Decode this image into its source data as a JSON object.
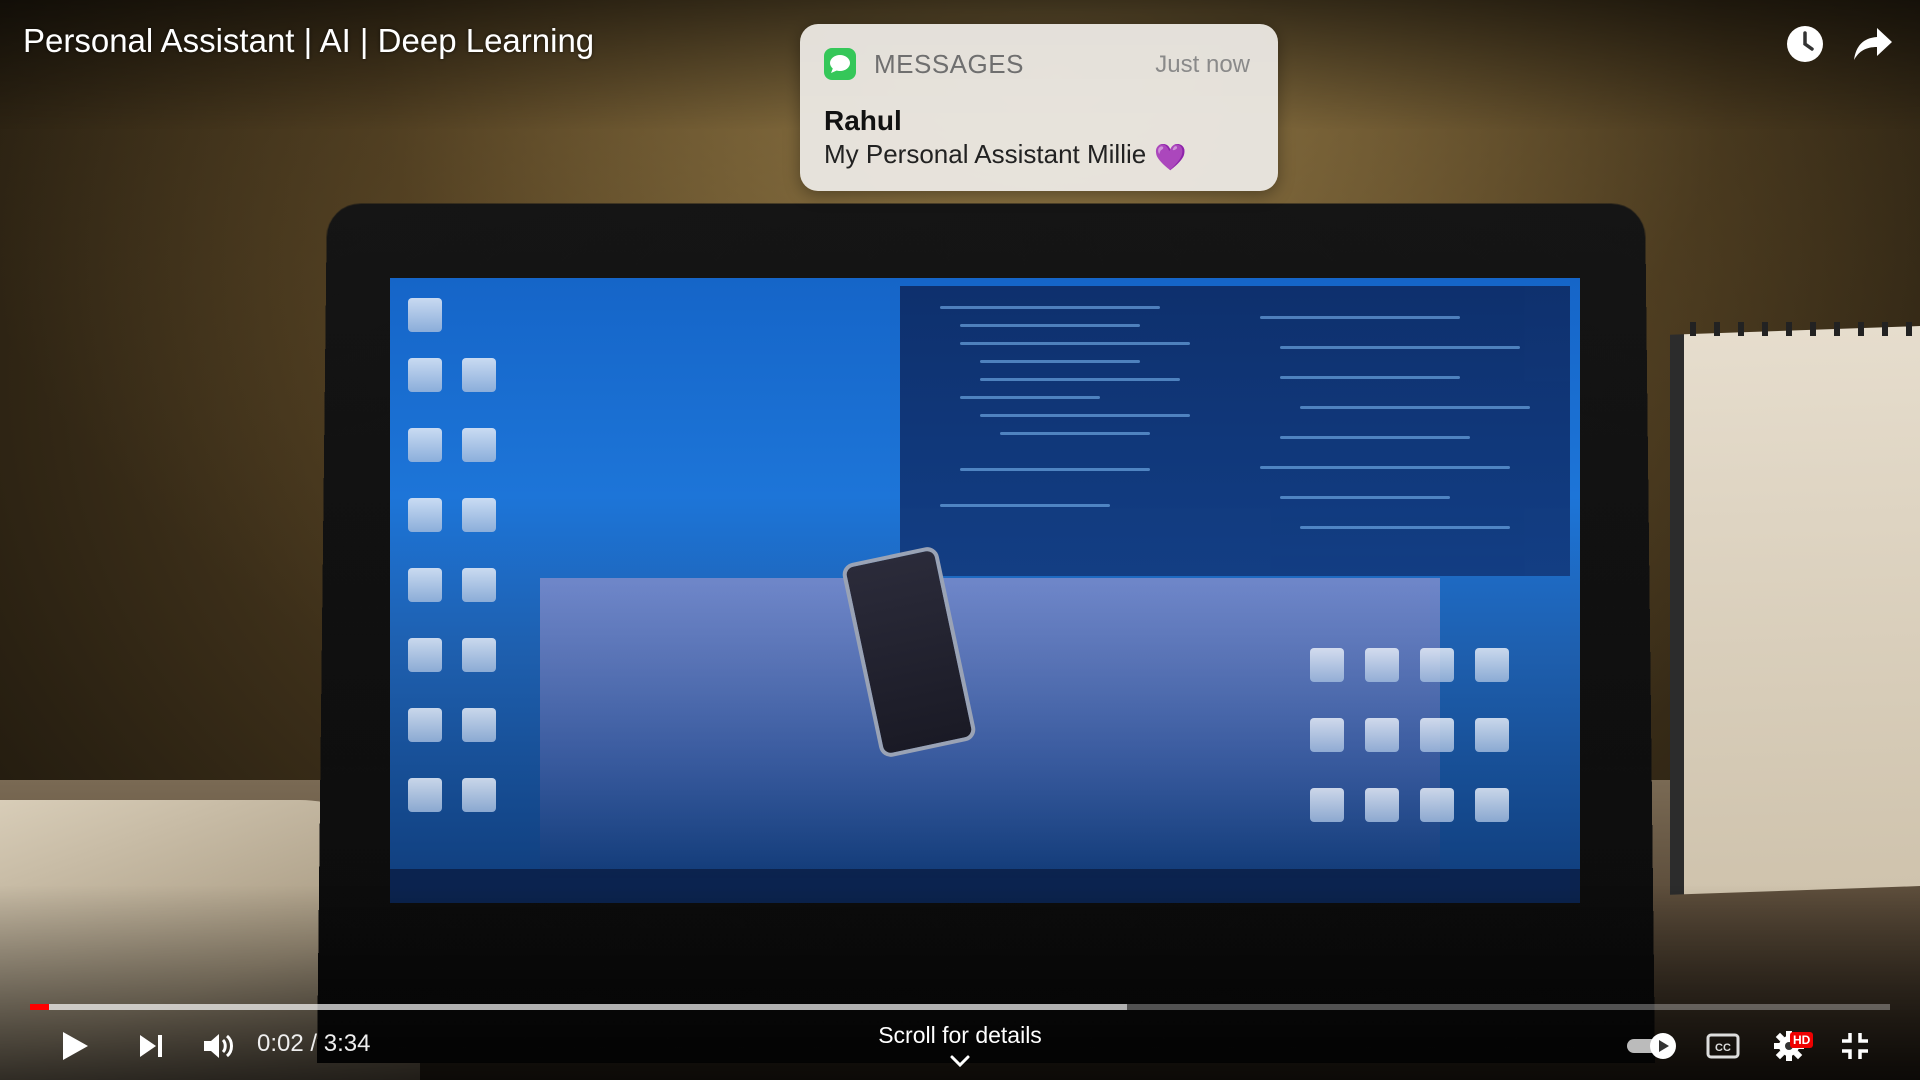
{
  "video": {
    "title": "Personal Assistant | AI | Deep Learning"
  },
  "top_actions": {
    "watch_later_icon": "clock-icon",
    "share_icon": "share-arrow-icon"
  },
  "notification": {
    "app_name": "MESSAGES",
    "time": "Just now",
    "sender": "Rahul",
    "body": "My Personal Assistant Millie",
    "emoji": "💜"
  },
  "progress": {
    "played_fraction": 0.01,
    "buffered_fraction": 0.59,
    "played_color": "#ff0000"
  },
  "controls": {
    "play_icon": "play-icon",
    "next_icon": "next-icon",
    "volume_icon": "volume-icon",
    "time_current": "0:02",
    "time_separator": " / ",
    "time_total": "3:34",
    "time_text": "0:02 / 3:34",
    "scroll_hint": "Scroll for details",
    "autoplay_icon": "autoplay-toggle-icon",
    "captions_icon": "captions-icon",
    "settings_icon": "settings-gear-icon",
    "settings_badge": "HD",
    "exit_fullscreen_icon": "exit-fullscreen-icon"
  }
}
